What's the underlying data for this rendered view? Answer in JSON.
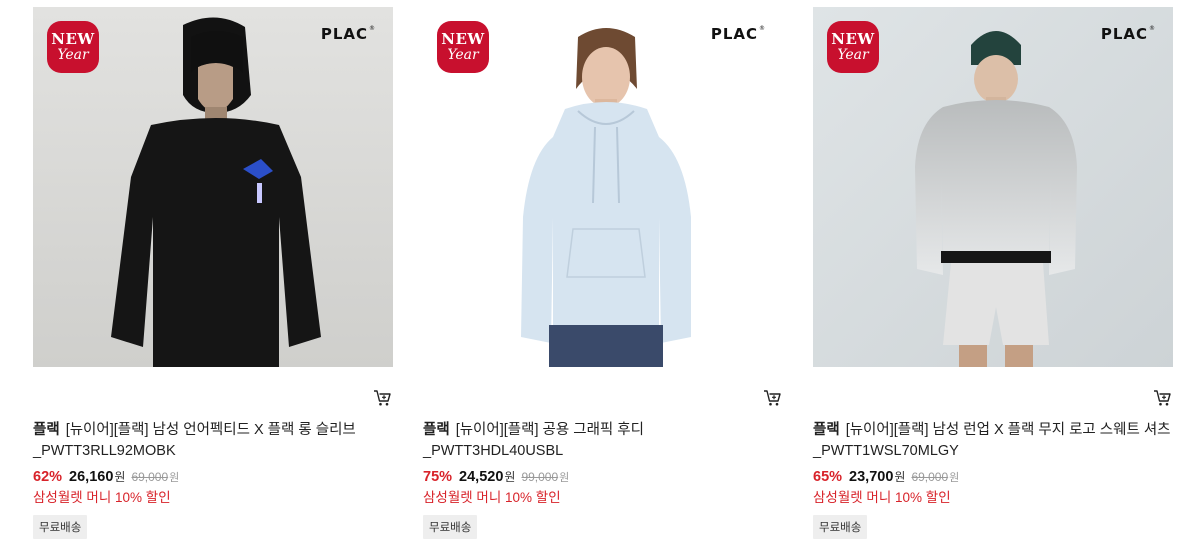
{
  "products": [
    {
      "badge_line1": "NEW",
      "badge_line2": "Year",
      "logo": "PLAC",
      "brand": "플랙",
      "name": "[뉴이어][플랙] 남성 언어펙티드 X 플랙 롱 슬리브 _PWTT3RLL92MOBK",
      "discount": "62%",
      "price": "26,160",
      "currency": "원",
      "original_price": "69,000",
      "original_currency": "원",
      "promo": "삼성월렛 머니 10% 할인",
      "shipping": "무료배송",
      "cart_icon": "cart-icon"
    },
    {
      "badge_line1": "NEW",
      "badge_line2": "Year",
      "logo": "PLAC",
      "brand": "플랙",
      "name": "[뉴이어][플랙] 공용 그래픽 후디 _PWTT3HDL40USBL",
      "discount": "75%",
      "price": "24,520",
      "currency": "원",
      "original_price": "99,000",
      "original_currency": "원",
      "promo": "삼성월렛 머니 10% 할인",
      "shipping": "무료배송",
      "cart_icon": "cart-icon"
    },
    {
      "badge_line1": "NEW",
      "badge_line2": "Year",
      "logo": "PLAC",
      "brand": "플랙",
      "name": "[뉴이어][플랙] 남성 런업 X 플랙 무지 로고 스웨트 셔츠_PWTT1WSL70MLGY",
      "discount": "65%",
      "price": "23,700",
      "currency": "원",
      "original_price": "69,000",
      "original_currency": "원",
      "promo": "삼성월렛 머니 10% 할인",
      "shipping": "무료배송",
      "cart_icon": "cart-icon"
    }
  ],
  "colors": {
    "badge": "#c8102e",
    "discount": "#d8232a",
    "ship_bg": "#eeeeee"
  }
}
